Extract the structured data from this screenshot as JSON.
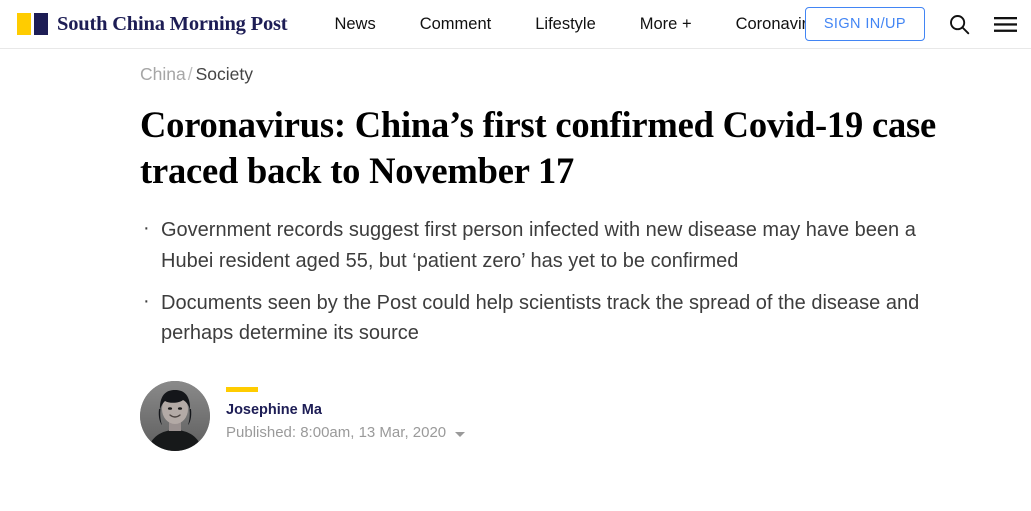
{
  "header": {
    "brand": {
      "name": "South China Morning Post",
      "mark_color_primary": "#ffcc00",
      "mark_color_secondary": "#1d1d55"
    },
    "nav_items": [
      {
        "label": "News"
      },
      {
        "label": "Comment"
      },
      {
        "label": "Lifestyle"
      },
      {
        "label": "More +"
      },
      {
        "label": "Coronavirus"
      }
    ],
    "sign_in_label": "SIGN IN/UP",
    "sign_in_color": "#4285f4",
    "search_icon": "search-icon",
    "menu_icon": "hamburger-menu-icon"
  },
  "breadcrumb": {
    "parent": "China",
    "separator": "/",
    "current": "Society"
  },
  "article": {
    "headline": "Coronavirus: China’s first confirmed Covid-19 case traced back to November 17",
    "bullets": [
      "Government records suggest first person infected with new disease may have been a Hubei resident aged 55, but ‘patient zero’ has yet to be confirmed",
      "Documents seen by the Post could help scientists track the spread of the disease and perhaps determine its source"
    ]
  },
  "byline": {
    "avatar_alt": "Josephine Ma portrait",
    "accent_color": "#ffcc00",
    "author": "Josephine Ma",
    "published": "Published: 8:00am, 13 Mar, 2020",
    "expand_icon": "chevron-down-icon"
  }
}
